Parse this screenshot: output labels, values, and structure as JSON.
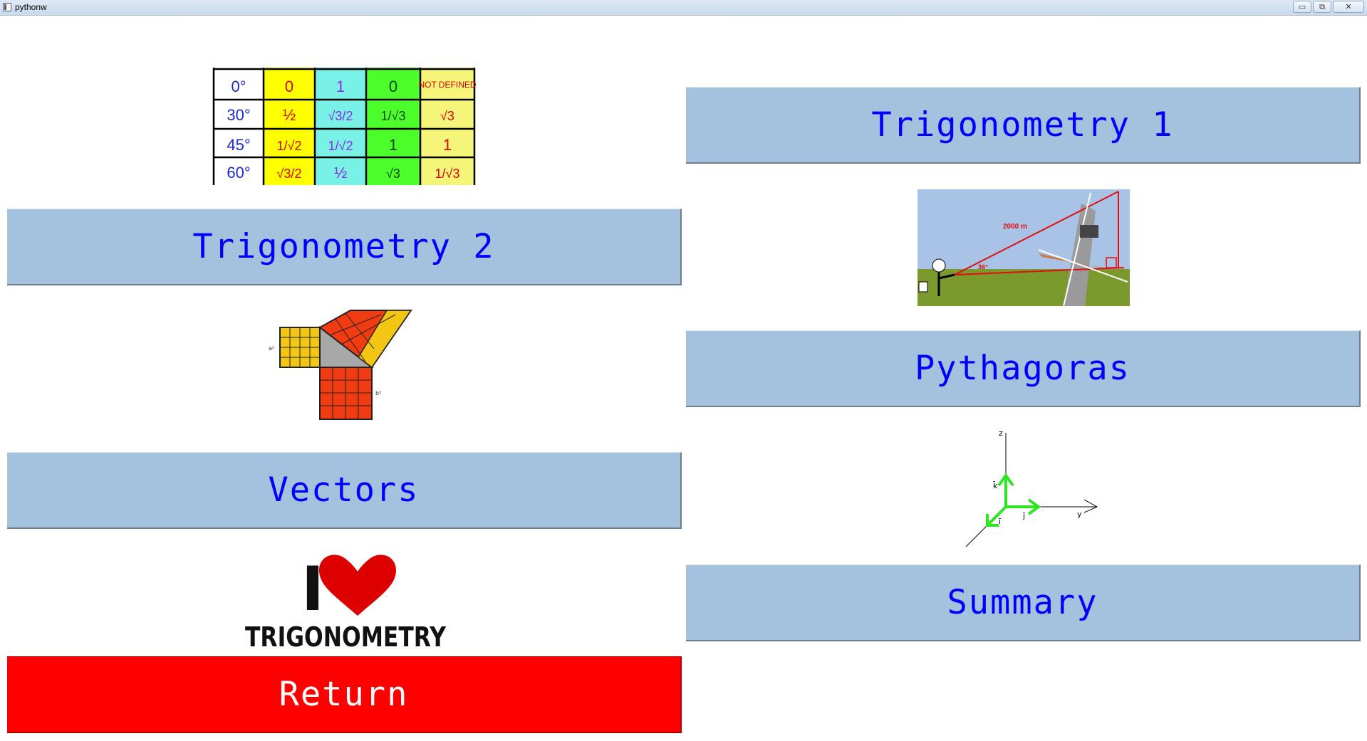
{
  "window": {
    "title": "pythonw",
    "controls": {
      "minimize": "▭",
      "restore": "⧉",
      "close": "✕"
    }
  },
  "buttons": {
    "trig1": "Trigonometry 1",
    "trig2": "Trigonometry 2",
    "pythagoras": "Pythagoras",
    "vectors": "Vectors",
    "summary": "Summary",
    "return": "Return"
  },
  "images": {
    "trig_table": {
      "icon": "trig-values-table-image",
      "rows": [
        {
          "angle": "0°",
          "sin": "0",
          "cos": "1",
          "tan": "0",
          "other": "NOT DEFINED"
        },
        {
          "angle": "30°",
          "sin": "½",
          "cos": "√3/2",
          "tan": "1/√3",
          "other": "√3"
        },
        {
          "angle": "45°",
          "sin": "1/√2",
          "cos": "1/√2",
          "tan": "1",
          "other": "1"
        },
        {
          "angle": "60°",
          "sin": "√3/2",
          "cos": "½",
          "tan": "√3",
          "other": "1/√3"
        }
      ],
      "colors": {
        "sin": "#ffff00",
        "cos": "#79f1e6",
        "tan": "#4cff2a",
        "other": "#f5f57a"
      }
    },
    "trig_scene": {
      "icon": "trig-elevation-scene-image",
      "distance": "2000 m",
      "angle": "36°"
    },
    "pythagoras": {
      "icon": "pythagoras-squares-image",
      "label_a": "a²",
      "label_b": "b²"
    },
    "vectors": {
      "icon": "vector-axes-image",
      "z": "z",
      "y": "y",
      "k": "k̄",
      "i": "ī",
      "j": "j̄"
    },
    "love_logo": {
      "icon": "i-love-trigonometry-logo",
      "text_i": "I",
      "text_word": "TRIGONOMETRY"
    }
  },
  "colors": {
    "button_bg": "#a4c2dd",
    "button_text": "#0000ff",
    "return_bg": "#ff0000",
    "return_text": "#ffffff"
  }
}
